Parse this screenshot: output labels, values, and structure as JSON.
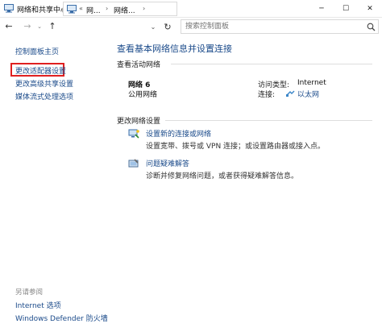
{
  "window": {
    "title": "网络和共享中心",
    "minimize_symbol": "─",
    "maximize_symbol": "☐",
    "close_symbol": "✕"
  },
  "nav": {
    "back_symbol": "←",
    "forward_symbol": "→",
    "recent_symbol": "⌄",
    "up_symbol": "↑",
    "separator_symbol": "›",
    "overflow_symbol": "«",
    "breadcrumbs": [
      "网...",
      "网络..."
    ],
    "dropdown_symbol": "⌄",
    "refresh_symbol": "↻",
    "search_placeholder": "搜索控制面板"
  },
  "left_pane": {
    "home_link": "控制面板主页",
    "links": [
      "更改适配器设置",
      "更改高级共享设置",
      "媒体流式处理选项"
    ],
    "see_also_header": "另请参阅",
    "see_also_links": [
      "Internet 选项",
      "Windows Defender 防火墙"
    ]
  },
  "main": {
    "title": "查看基本网络信息并设置连接",
    "active_networks_header": "查看活动网络",
    "network": {
      "name": "网络 6",
      "type": "公用网络",
      "access_type_label": "访问类型:",
      "access_type_value": "Internet",
      "connections_label": "连接:",
      "connection_value": "以太网"
    },
    "change_settings_header": "更改网络设置",
    "tasks": [
      {
        "icon": "new-connection-icon",
        "link": "设置新的连接或网络",
        "desc": "设置宽带、拨号或 VPN 连接；或设置路由器或接入点。"
      },
      {
        "icon": "troubleshoot-icon",
        "link": "问题疑难解答",
        "desc": "诊断并修复网络问题，或者获得疑难解答信息。"
      }
    ]
  },
  "colors": {
    "link": "#1a4a8a",
    "highlight_border": "#e02020"
  }
}
